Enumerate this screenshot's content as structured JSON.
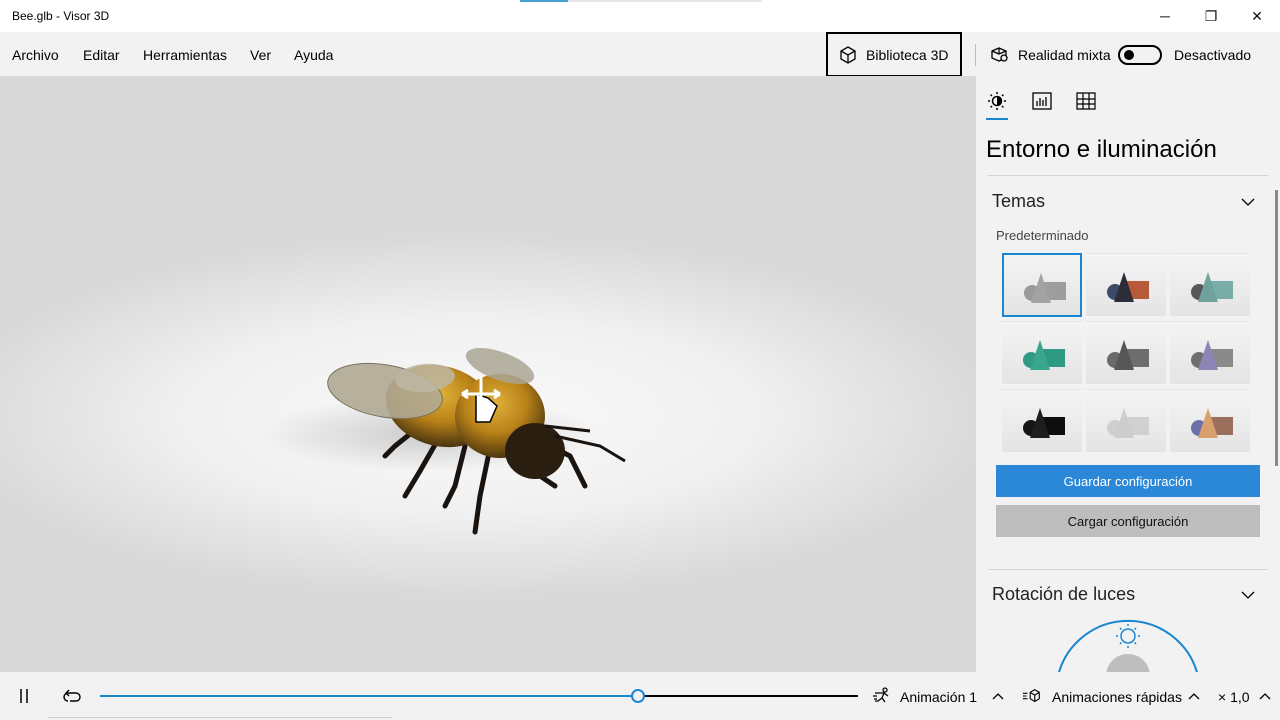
{
  "window": {
    "title": "Bee.glb - Visor 3D",
    "min_glyph": "─",
    "max_glyph": "❐",
    "close_glyph": "✕"
  },
  "menu": {
    "items": [
      "Archivo",
      "Editar",
      "Herramientas",
      "Ver",
      "Ayuda"
    ]
  },
  "toolbar": {
    "library_label": "Biblioteca 3D",
    "mixed_reality_label": "Realidad mixta",
    "mixed_reality_state": "Desactivado",
    "mixed_reality_on": false
  },
  "panel": {
    "title": "Entorno e iluminación",
    "tabs": [
      "sun-icon",
      "stats-icon",
      "grid-icon"
    ],
    "active_tab": "sun-icon",
    "themes_section": "Temas",
    "themes_subheading": "Predeterminado",
    "themes": [
      {
        "name": "theme-1",
        "ball": "#9a9a9a",
        "cone": "#a3a3a3",
        "box": "#9d9d9d",
        "selected": true
      },
      {
        "name": "theme-2",
        "ball": "#3b4a66",
        "cone": "#2d2d3a",
        "box": "#b65a3a",
        "selected": false
      },
      {
        "name": "theme-3",
        "ball": "#565656",
        "cone": "#6fa29c",
        "box": "#79aea8",
        "selected": false
      },
      {
        "name": "theme-4",
        "ball": "#2f9a84",
        "cone": "#3aa68d",
        "box": "#2f9a84",
        "selected": false
      },
      {
        "name": "theme-5",
        "ball": "#6a6a6a",
        "cone": "#575757",
        "box": "#6e6e6e",
        "selected": false
      },
      {
        "name": "theme-6",
        "ball": "#6f6f6f",
        "cone": "#8c86b6",
        "box": "#8a8a8a",
        "selected": false
      },
      {
        "name": "theme-7",
        "ball": "#151515",
        "cone": "#1e1e1e",
        "box": "#0e0e0e",
        "selected": false
      },
      {
        "name": "theme-8",
        "ball": "#cfcfcf",
        "cone": "#cdcdcd",
        "box": "#d0d0d0",
        "selected": false
      },
      {
        "name": "theme-9",
        "ball": "#6c6fa8",
        "cone": "#d8a06c",
        "box": "#9a6f5c",
        "selected": false
      }
    ],
    "save_label": "Guardar configuración",
    "load_label": "Cargar configuración",
    "light_rotation_section": "Rotación de luces"
  },
  "playback": {
    "progress": 0.71,
    "animation_label": "Animación 1",
    "quick_animations_label": "Animaciones rápidas",
    "speed_label": "× 1,0"
  },
  "colors": {
    "accent": "#1a86d0",
    "primary_button": "#2b88d8",
    "secondary_button": "#bdbdbd"
  }
}
